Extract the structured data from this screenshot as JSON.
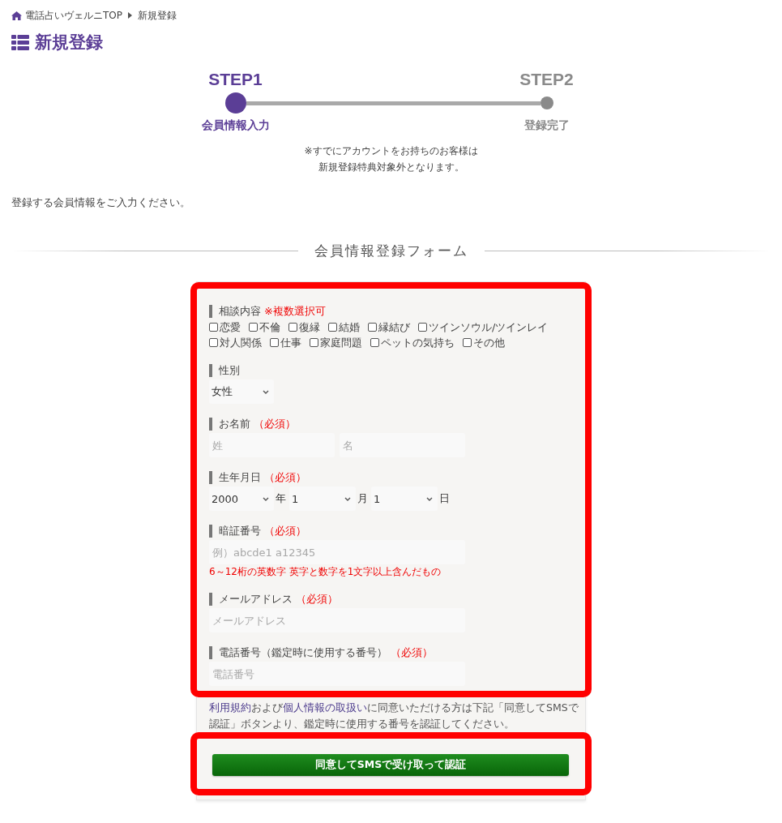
{
  "breadcrumb": {
    "items": [
      {
        "label": "電話占いヴェルニTOP",
        "kind": "home"
      },
      {
        "label": "新規登録",
        "kind": "current"
      }
    ]
  },
  "page_title": "新規登録",
  "steps": [
    {
      "label": "STEP1",
      "caption": "会員情報入力",
      "selected": true
    },
    {
      "label": "STEP2",
      "caption": "登録完了",
      "selected": false
    }
  ],
  "notice": [
    "※すでにアカウントをお持ちのお客様は",
    "新規登録特典対象外となります。"
  ],
  "intro": "登録する会員情報をご入力ください。",
  "form": {
    "heading": "会員情報登録フォーム",
    "highlighted": true,
    "fields": [
      {
        "kind": "checkboxes",
        "label": "相談内容",
        "note": "※複数選択可",
        "options": [
          {
            "label": "恋愛",
            "checked": false
          },
          {
            "label": "不倫",
            "checked": false
          },
          {
            "label": "復縁",
            "checked": false
          },
          {
            "label": "結婚",
            "checked": false
          },
          {
            "label": "縁結び",
            "checked": false
          },
          {
            "label": "ツインソウル/ツインレイ",
            "checked": false
          },
          {
            "label": "対人関係",
            "checked": false
          },
          {
            "label": "仕事",
            "checked": false
          },
          {
            "label": "家庭問題",
            "checked": false
          },
          {
            "label": "ペットの気持ち",
            "checked": false
          },
          {
            "label": "その他",
            "checked": false
          }
        ]
      },
      {
        "kind": "select",
        "label": "性別",
        "value": "女性"
      },
      {
        "kind": "inputs",
        "label": "お名前",
        "note": "（必須）",
        "inputs": [
          {
            "placeholder": "姓"
          },
          {
            "placeholder": "名"
          }
        ]
      },
      {
        "kind": "date",
        "label": "生年月日",
        "note": "（必須）",
        "selects": [
          {
            "value": "2000",
            "unit": "年"
          },
          {
            "value": "1",
            "unit": "月"
          },
          {
            "value": "1",
            "unit": "日"
          }
        ]
      },
      {
        "kind": "inputs",
        "label": "暗証番号",
        "note": "（必須）",
        "inputs": [
          {
            "placeholder": "例）abcde1 a12345"
          }
        ],
        "hint": "6～12桁の英数字 英字と数字を1文字以上含んだもの"
      },
      {
        "kind": "inputs",
        "label": "メールアドレス",
        "note": "（必須）",
        "inputs": [
          {
            "placeholder": "メールアドレス"
          }
        ]
      },
      {
        "kind": "inputs",
        "label": "電話番号（鑑定時に使用する番号）",
        "note": "（必須）",
        "inputs": [
          {
            "placeholder": "電話番号"
          }
        ]
      }
    ]
  },
  "consent": [
    {
      "kind": "link",
      "text": "利用規約"
    },
    {
      "kind": "text",
      "text": "および"
    },
    {
      "kind": "link",
      "text": "個人情報の取扱い"
    },
    {
      "kind": "text",
      "text": "に同意いただける方は下記「同意してSMSで認証」ボタンより、鑑定時に使用する番号を認証してください。"
    }
  ],
  "submit": {
    "label": "同意してSMSで受け取って認証",
    "highlighted": true
  }
}
